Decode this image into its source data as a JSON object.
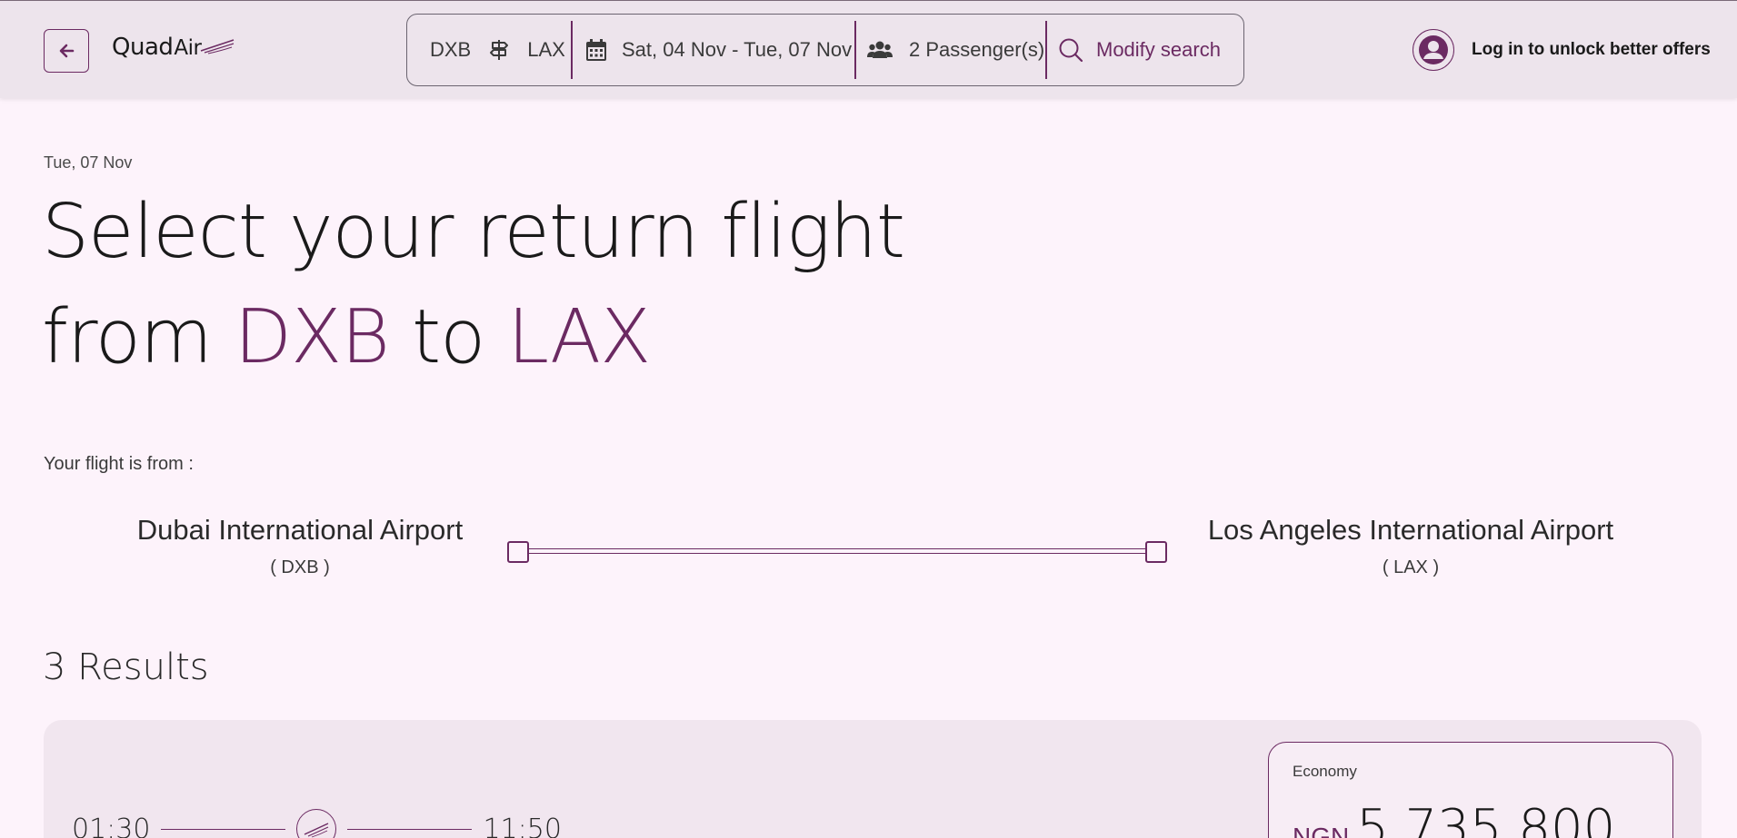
{
  "header": {
    "logo_main": "Quad",
    "logo_sub": "Air",
    "search": {
      "origin": "DXB",
      "destination": "LAX",
      "dates": "Sat, 04 Nov - Tue, 07 Nov",
      "passengers": "2 Passenger(s)",
      "modify_label": "Modify search"
    },
    "login_label": "Log in to unlock better offers"
  },
  "main": {
    "date_label": "Tue, 07 Nov",
    "title_line1": "Select your return flight",
    "title_from": "from",
    "title_origin": "DXB",
    "title_to": "to",
    "title_destination": "LAX",
    "from_label": "Your flight is from :",
    "origin_airport": {
      "name": "Dubai International Airport",
      "code": "( DXB )"
    },
    "destination_airport": {
      "name": "Los Angeles International Airport",
      "code": "( LAX )"
    },
    "results_count": "3 Results"
  },
  "results": [
    {
      "depart_time": "01:30",
      "arrive_time": "11:50",
      "fare_class": "Economy",
      "currency": "NGN",
      "price": "5,735,800"
    }
  ],
  "colors": {
    "accent": "#6b2a62",
    "background": "#fdf3fb",
    "header_bg": "#ede4ec"
  },
  "icons": [
    "arrow-left-icon",
    "signpost-icon",
    "calendar-icon",
    "users-icon",
    "search-icon",
    "user-icon",
    "plane-icon"
  ]
}
